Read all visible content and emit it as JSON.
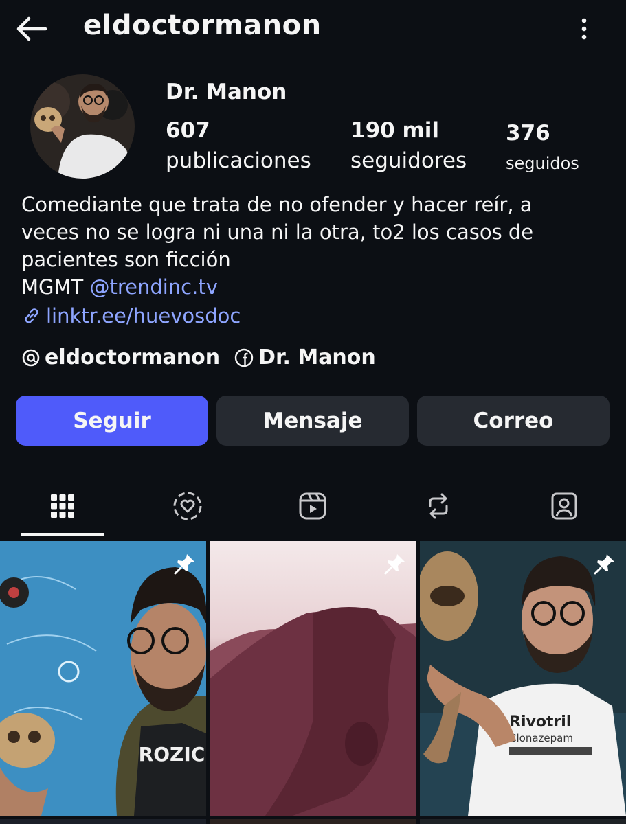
{
  "header": {
    "username": "eldoctormanon",
    "back_icon": "arrow-left-icon",
    "more_icon": "more-vertical-icon"
  },
  "profile": {
    "display_name": "Dr. Manon",
    "stats": [
      {
        "value": "607",
        "label": "publicaciones"
      },
      {
        "value": "190 mil",
        "label": "seguidores"
      },
      {
        "value": "376",
        "label": "seguidos"
      }
    ],
    "bio_lines": [
      "Comediante que trata de no ofender y hacer reír, a",
      "veces no se logra ni una ni la otra, to2 los casos de",
      "pacientes son ficción"
    ],
    "mgmt_prefix": "MGMT ",
    "mgmt_mention": "@trendinc.tv",
    "link": "linktr.ee/huevosdoc",
    "socials": [
      {
        "icon": "threads-icon",
        "label": "eldoctormanon"
      },
      {
        "icon": "facebook-icon",
        "label": "Dr. Manon"
      }
    ]
  },
  "actions": {
    "follow": "Seguir",
    "message": "Mensaje",
    "email": "Correo"
  },
  "tabs": [
    {
      "icon": "grid-icon",
      "active": true
    },
    {
      "icon": "heart-circle-icon",
      "active": false
    },
    {
      "icon": "reels-icon",
      "active": false
    },
    {
      "icon": "repost-icon",
      "active": false
    },
    {
      "icon": "tagged-person-icon",
      "active": false
    }
  ],
  "grid": {
    "pinned_icon": "pin-icon",
    "posts": [
      {
        "shirt_text": "ROZIC",
        "pinned": true
      },
      {
        "pinned": true
      },
      {
        "shirt_text": "Rivotril",
        "shirt_subtext": "Clonazepam",
        "pinned": true
      }
    ]
  },
  "colors": {
    "background": "#0c0f14",
    "accent": "#4f5bfa",
    "link": "#8ea5ff",
    "secondary_button": "#262a31"
  }
}
